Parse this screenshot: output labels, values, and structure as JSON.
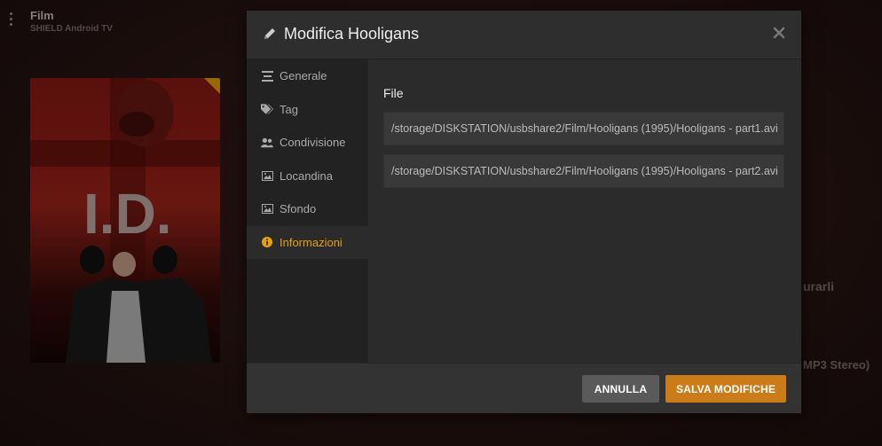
{
  "background": {
    "library_title": "Film",
    "server_name": "SHIELD Android TV",
    "partial_text_1": "urarli",
    "partial_text_2": "MP3 Stereo)",
    "poster_title": "I.D."
  },
  "modal": {
    "title": "Modifica Hooligans",
    "sidebar": [
      {
        "label": "Generale",
        "icon": "list-icon"
      },
      {
        "label": "Tag",
        "icon": "tag-icon"
      },
      {
        "label": "Condivisione",
        "icon": "users-icon"
      },
      {
        "label": "Locandina",
        "icon": "image-icon"
      },
      {
        "label": "Sfondo",
        "icon": "image-icon"
      },
      {
        "label": "Informazioni",
        "icon": "info-icon",
        "active": true
      }
    ],
    "section_label": "File",
    "files": [
      "/storage/DISKSTATION/usbshare2/Film/Hooligans (1995)/Hooligans - part1.avi",
      "/storage/DISKSTATION/usbshare2/Film/Hooligans (1995)/Hooligans - part2.avi"
    ],
    "buttons": {
      "cancel": "Annulla",
      "save": "Salva modifiche"
    }
  },
  "colors": {
    "accent": "#e5a00d",
    "save_button": "#cc7b19",
    "cancel_button": "#5a5a5a"
  }
}
